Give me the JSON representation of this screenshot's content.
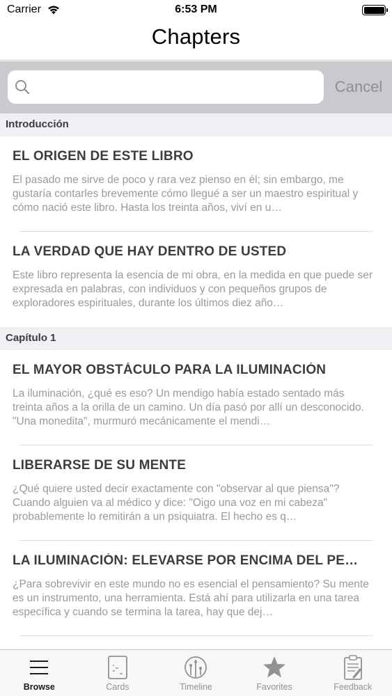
{
  "status_bar": {
    "carrier": "Carrier",
    "time": "6:53 PM"
  },
  "nav": {
    "title": "Chapters"
  },
  "search": {
    "placeholder": "",
    "value": "",
    "cancel_label": "Cancel"
  },
  "sections": [
    {
      "header": "Introducción",
      "rows": [
        {
          "title": "EL ORIGEN DE ESTE LIBRO",
          "body": "El pasado me sirve de poco y rara vez pienso en él; sin embargo, me gustaría contarles brevemente cómo llegué a ser un maestro espiritual y cómo nació este libro. Hasta los treinta años, viví en u…"
        },
        {
          "title": "LA VERDAD QUE HAY DENTRO DE USTED",
          "body": "Este libro representa la esencia de mi obra, en la medida en que puede ser expresada en palabras, con individuos y con pequeños grupos de exploradores espirituales, durante los últimos diez año…"
        }
      ]
    },
    {
      "header": "Capítulo 1",
      "rows": [
        {
          "title": "EL MAYOR OBSTÁCULO PARA LA ILUMINACIÓN",
          "body": "La iluminación, ¿qué es eso? Un mendigo había estado sentado más treinta años a la orilla de un camino. Un día pasó por allí un desconocido. \"Una monedita\", murmuró mecánicamente el mendi…"
        },
        {
          "title": "LIBERARSE DE SU MENTE",
          "body": "¿Qué quiere usted decir exactamente con \"observar al que piensa\"? Cuando alguien va al médico y dice: \"Oigo una voz en mi cabeza\" probablemente lo remitirán a un psiquiatra. El hecho es q…"
        },
        {
          "title": "LA ILUMINACIÓN: ELEVARSE POR ENCIMA DEL PE…",
          "body": "¿Para sobrevivir en este mundo no es esencial el pensamiento? Su mente es un instrumento, una herramienta. Está ahí para utilizarla en una tarea específica y cuando se termina la tarea, hay que dej…"
        }
      ]
    }
  ],
  "tabs": [
    {
      "label": "Browse",
      "icon": "list-icon",
      "active": true
    },
    {
      "label": "Cards",
      "icon": "card-icon",
      "active": false
    },
    {
      "label": "Timeline",
      "icon": "timeline-icon",
      "active": false
    },
    {
      "label": "Favorites",
      "icon": "star-icon",
      "active": false
    },
    {
      "label": "Feedback",
      "icon": "clipboard-icon",
      "active": false
    }
  ]
}
